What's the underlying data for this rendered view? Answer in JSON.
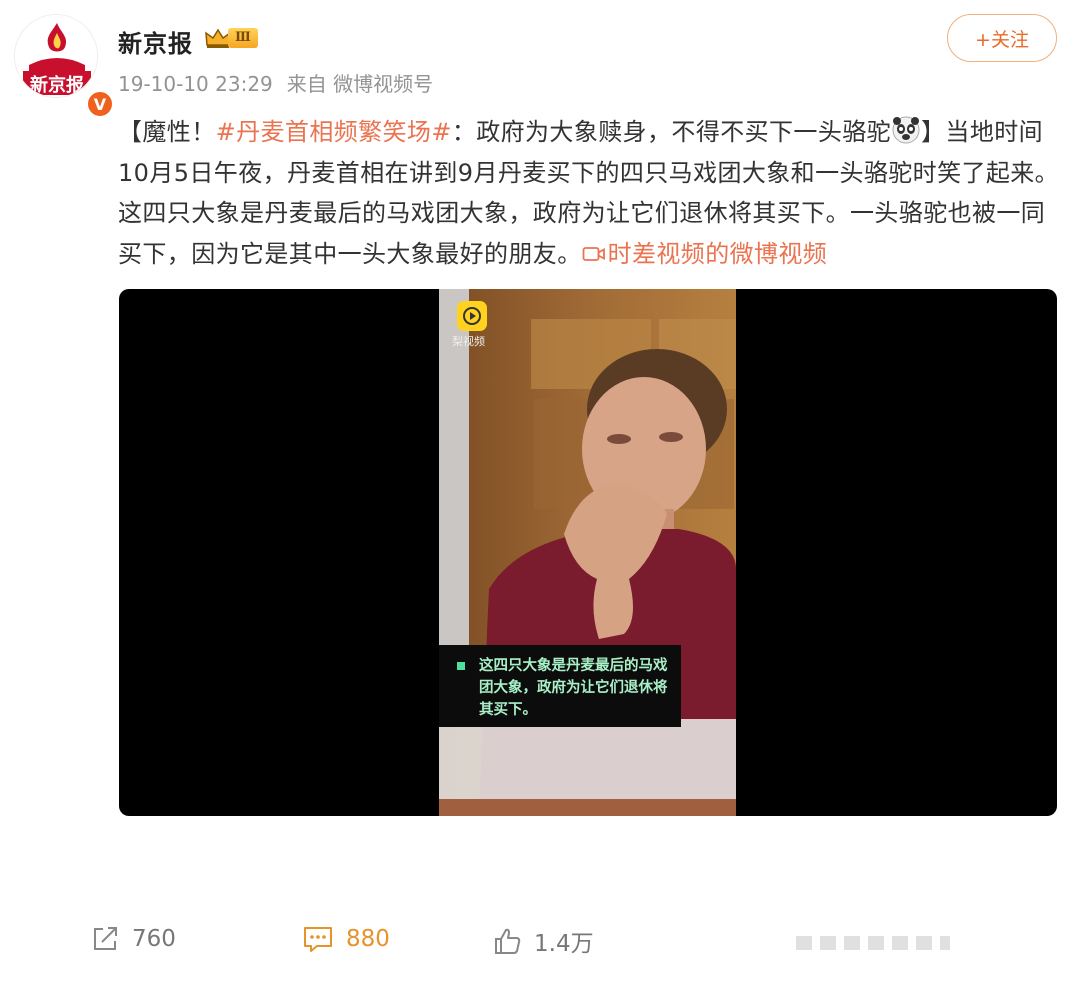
{
  "author": {
    "name": "新京报",
    "avatar_text": "新京报",
    "vip_level": "Ⅲ",
    "verified_mark": "V"
  },
  "meta": {
    "time": "19-10-10 23:29",
    "source": "来自 微博视频号"
  },
  "follow_button": "+关注",
  "post": {
    "seg1": "【魔性！",
    "hashtag": "#丹麦首相频繁笑场#",
    "seg2": "：政府为大象赎身，不得不买下一头骆驼",
    "seg3": "】当地时间10月5日午夜，丹麦首相在讲到9月丹麦买下的四只马戏团大象和一头骆驼时笑了起来。这四只大象是丹麦最后的马戏团大象，政府为让它们退休将其买下。一头骆驼也被一同买下，因为它是其中一头大象最好的朋友。",
    "link_text": "时差视频的微博视频"
  },
  "video": {
    "brand": "梨视频",
    "subtitle": "这四只大象是丹麦最后的马戏团大象，政府为让它们退休将其买下。"
  },
  "actions": {
    "repost_count": "760",
    "comment_count": "880",
    "like_count": "1.4万"
  },
  "colors": {
    "accent": "#eb7350",
    "follow_border": "#f0b080",
    "comment_active": "#e8922a",
    "subtitle_green": "#a8f0c8"
  },
  "icons": [
    "share-icon",
    "comment-icon",
    "like-icon",
    "video-link-icon",
    "more-icon"
  ]
}
